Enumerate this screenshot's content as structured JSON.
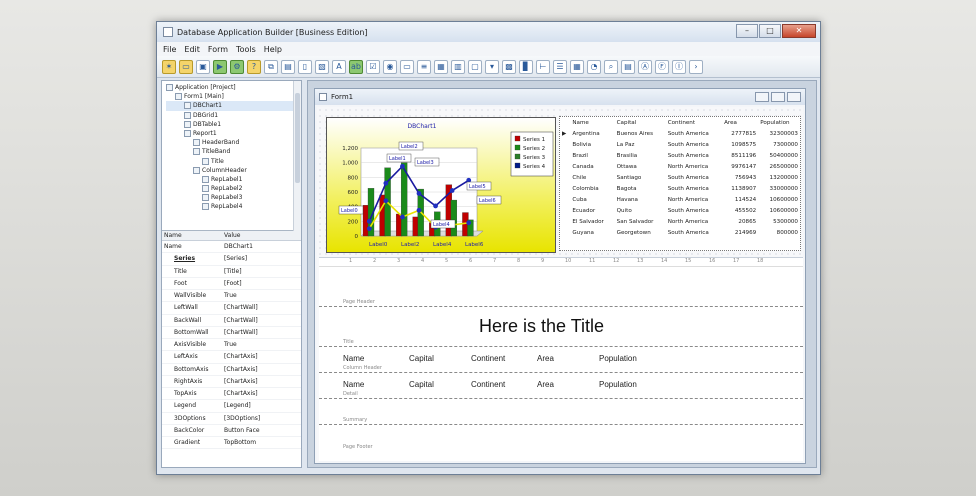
{
  "window": {
    "title": "Database Application Builder [Business Edition]"
  },
  "menu": [
    "File",
    "Edit",
    "Form",
    "Tools",
    "Help"
  ],
  "tree": [
    {
      "label": "Application [Project]",
      "indent": 0
    },
    {
      "label": "Form1 [Main]",
      "indent": 1
    },
    {
      "label": "DBChart1",
      "indent": 2
    },
    {
      "label": "DBGrid1",
      "indent": 2
    },
    {
      "label": "DBTable1",
      "indent": 2
    },
    {
      "label": "Report1",
      "indent": 2
    },
    {
      "label": "HeaderBand",
      "indent": 3
    },
    {
      "label": "TitleBand",
      "indent": 3
    },
    {
      "label": "Title",
      "indent": 4
    },
    {
      "label": "ColumnHeader",
      "indent": 3
    },
    {
      "label": "RepLabel1",
      "indent": 4
    },
    {
      "label": "RepLabel2",
      "indent": 4
    },
    {
      "label": "RepLabel3",
      "indent": 4
    },
    {
      "label": "RepLabel4",
      "indent": 4
    }
  ],
  "props": {
    "header": {
      "name": "Name",
      "value": "Value"
    },
    "rows": [
      {
        "k": "Name",
        "v": "DBChart1"
      },
      {
        "k": "Series",
        "v": "[Series]"
      },
      {
        "k": "Title",
        "v": "[Title]"
      },
      {
        "k": "Foot",
        "v": "[Foot]"
      },
      {
        "k": "WallVisible",
        "v": "True"
      },
      {
        "k": "LeftWall",
        "v": "[ChartWall]"
      },
      {
        "k": "BackWall",
        "v": "[ChartWall]"
      },
      {
        "k": "BottomWall",
        "v": "[ChartWall]"
      },
      {
        "k": "AxisVisible",
        "v": "True"
      },
      {
        "k": "LeftAxis",
        "v": "[ChartAxis]"
      },
      {
        "k": "BottomAxis",
        "v": "[ChartAxis]"
      },
      {
        "k": "RightAxis",
        "v": "[ChartAxis]"
      },
      {
        "k": "TopAxis",
        "v": "[ChartAxis]"
      },
      {
        "k": "Legend",
        "v": "[Legend]"
      },
      {
        "k": "3DOptions",
        "v": "[3DOptions]"
      },
      {
        "k": "BackColor",
        "v": "Button Face"
      },
      {
        "k": "Gradient",
        "v": "TopBottom"
      }
    ]
  },
  "form": {
    "title": "Form1"
  },
  "chart": {
    "title": "DBChart1",
    "yticks": [
      "1,200",
      "1,000",
      "800",
      "600",
      "400",
      "200",
      "0"
    ],
    "xlabels": [
      "Label0",
      "Label2",
      "Label4",
      "Label6"
    ],
    "legend": [
      "Series 1",
      "Series 2",
      "Series 3",
      "Series 4"
    ],
    "callouts": [
      "Label1",
      "Label2",
      "Label3",
      "Label4",
      "Label5",
      "Label6",
      "Label0"
    ]
  },
  "grid": {
    "columns": [
      "Name",
      "Capital",
      "Continent",
      "Area",
      "Population"
    ],
    "rows": [
      [
        "Argentina",
        "Buenos Aires",
        "South America",
        "2777815",
        "32300003"
      ],
      [
        "Bolivia",
        "La Paz",
        "South America",
        "1098575",
        "7300000"
      ],
      [
        "Brazil",
        "Brasilia",
        "South America",
        "8511196",
        "50400000"
      ],
      [
        "Canada",
        "Ottawa",
        "North America",
        "9976147",
        "26500000"
      ],
      [
        "Chile",
        "Santiago",
        "South America",
        "756943",
        "13200000"
      ],
      [
        "Colombia",
        "Bagota",
        "South America",
        "1138907",
        "33000000"
      ],
      [
        "Cuba",
        "Havana",
        "North America",
        "114524",
        "10600000"
      ],
      [
        "Ecuador",
        "Quito",
        "South America",
        "455502",
        "10600000"
      ],
      [
        "El Salvador",
        "San Salvador",
        "North America",
        "20865",
        "5300000"
      ],
      [
        "Guyana",
        "Georgetown",
        "South America",
        "214969",
        "800000"
      ]
    ]
  },
  "report": {
    "title": "Here is the Title",
    "bands": [
      "Page Header",
      "Title",
      "Column Header",
      "Detail",
      "Summary",
      "Page Footer"
    ],
    "col_header": [
      "Name",
      "Capital",
      "Continent",
      "Area",
      "Population"
    ],
    "detail": [
      "Name",
      "Capital",
      "Continent",
      "Area",
      "Population"
    ]
  },
  "chart_data": {
    "type": "bar",
    "title": "DBChart1",
    "categories": [
      "Label0",
      "Label1",
      "Label2",
      "Label3",
      "Label4",
      "Label5",
      "Label6"
    ],
    "series": [
      {
        "name": "Series 1",
        "values": [
          420,
          560,
          300,
          260,
          180,
          700,
          320
        ]
      },
      {
        "name": "Series 2",
        "values": [
          650,
          930,
          1000,
          640,
          330,
          490,
          220
        ]
      },
      {
        "name": "Series 3",
        "values": [
          100,
          480,
          260,
          350,
          120,
          150,
          180
        ]
      },
      {
        "name": "Series 4",
        "values": [
          200,
          720,
          950,
          580,
          410,
          620,
          760
        ]
      }
    ],
    "ylim": [
      0,
      1200
    ],
    "legend": "top-right"
  }
}
